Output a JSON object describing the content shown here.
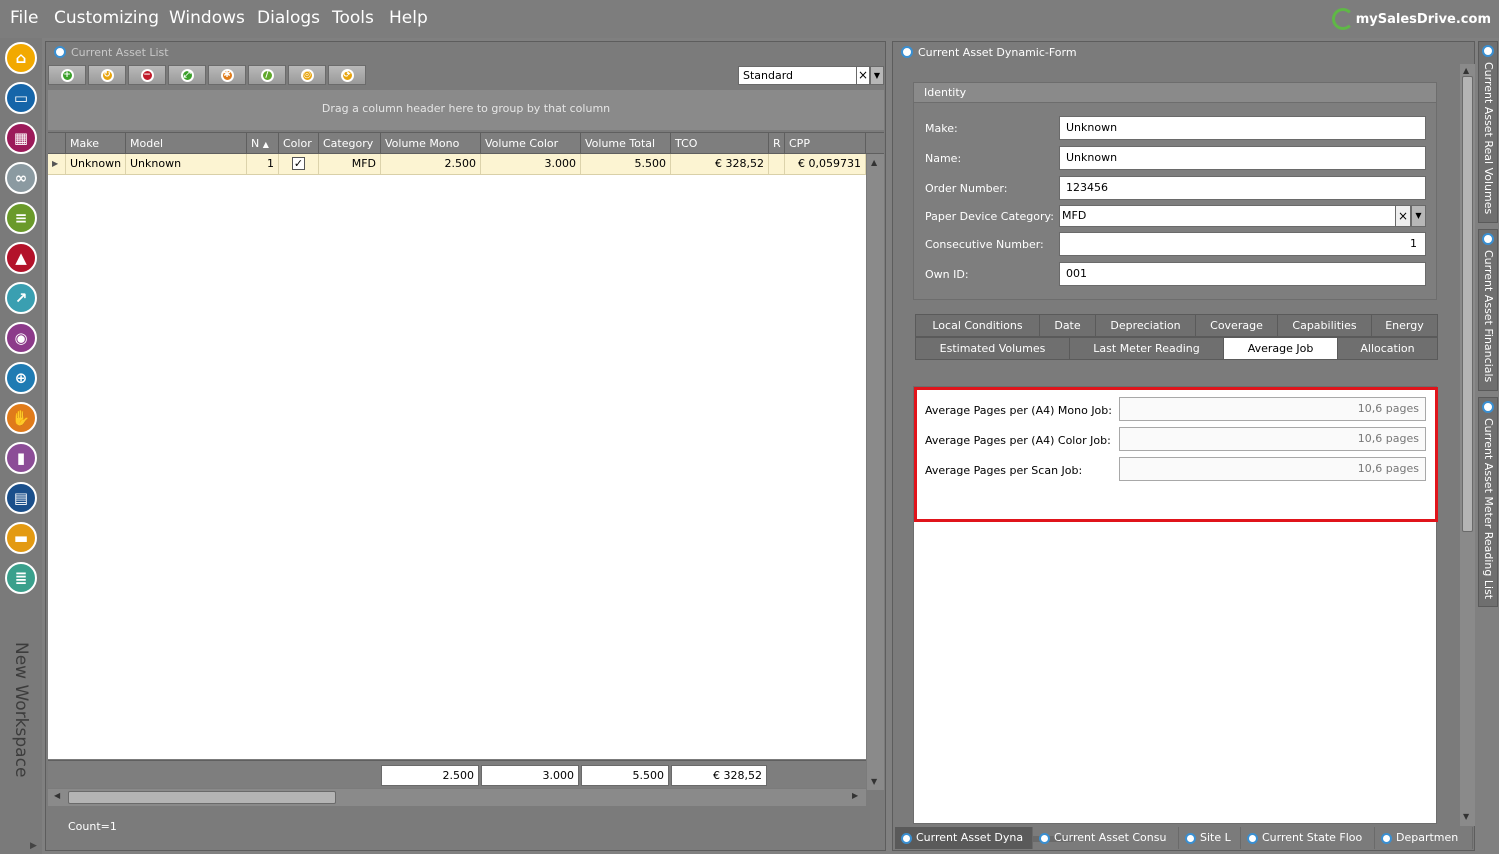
{
  "menu": {
    "items": [
      "File",
      "Customizing",
      "Windows",
      "Dialogs",
      "Tools",
      "Help"
    ],
    "brand": "mySalesDrive.com"
  },
  "sidebar": {
    "icons": [
      {
        "name": "home-icon",
        "color": "#f2a900",
        "glyph": "⌂"
      },
      {
        "name": "folder-icon",
        "color": "#1565a9",
        "glyph": "▭"
      },
      {
        "name": "hierarchy-icon",
        "color": "#9c1a5a",
        "glyph": "▦"
      },
      {
        "name": "binoculars-icon",
        "color": "#8b9aa1",
        "glyph": "∞"
      },
      {
        "name": "scroll-icon",
        "color": "#6a9a2a",
        "glyph": "≡"
      },
      {
        "name": "chart-icon",
        "color": "#b3122a",
        "glyph": "▲"
      },
      {
        "name": "trend-icon",
        "color": "#3a9fb1",
        "glyph": "↗"
      },
      {
        "name": "eye-icon",
        "color": "#8c3a8a",
        "glyph": "◉"
      },
      {
        "name": "target-icon",
        "color": "#1f7bb3",
        "glyph": "⊕"
      },
      {
        "name": "handshake-icon",
        "color": "#e07b1a",
        "glyph": "✋"
      },
      {
        "name": "bar-chart-icon",
        "color": "#8c4d97",
        "glyph": "▮"
      },
      {
        "name": "document-icon",
        "color": "#1a4f8b",
        "glyph": "▤"
      },
      {
        "name": "briefcase-icon",
        "color": "#e39a12",
        "glyph": "▬"
      },
      {
        "name": "database-icon",
        "color": "#3aa08c",
        "glyph": "≣"
      }
    ],
    "workspace_label": "New Workspace"
  },
  "left_panel": {
    "title": "Current Asset List",
    "view_select": "Standard",
    "group_hint": "Drag a column header here to group by that column",
    "columns": [
      "Make",
      "Model",
      "N",
      "Color",
      "Category",
      "Volume Mono",
      "Volume Color",
      "Volume Total",
      "TCO",
      "R",
      "CPP"
    ],
    "row": {
      "make": "Unknown",
      "model": "Unknown",
      "n": "1",
      "color_checked": "✓",
      "category": "MFD",
      "volume_mono": "2.500",
      "volume_color": "3.000",
      "volume_total": "5.500",
      "tco": "€ 328,52",
      "cpp": "€ 0,059731"
    },
    "totals": {
      "volume_mono": "2.500",
      "volume_color": "3.000",
      "volume_total": "5.500",
      "tco": "€ 328,52"
    },
    "count": "Count=1"
  },
  "right_panel": {
    "title": "Current Asset Dynamic-Form",
    "identity": {
      "title": "Identity",
      "fields": [
        {
          "label": "Make:",
          "value": "Unknown"
        },
        {
          "label": "Name:",
          "value": "Unknown"
        },
        {
          "label": "Order Number:",
          "value": "123456"
        },
        {
          "label": "Paper Device Category:",
          "value": "MFD"
        },
        {
          "label": "Consecutive Number:",
          "value": "1"
        },
        {
          "label": "Own ID:",
          "value": "001"
        }
      ]
    },
    "tabs_row1": [
      "Local Conditions",
      "Date",
      "Depreciation",
      "Coverage",
      "Capabilities",
      "Energy"
    ],
    "tabs_row2": [
      "Estimated Volumes",
      "Last Meter Reading",
      "Average Job",
      "Allocation"
    ],
    "active_tab": "Average Job",
    "average_job": [
      {
        "label": "Average Pages per (A4) Mono Job:",
        "value": "10,6 pages"
      },
      {
        "label": "Average Pages per (A4) Color Job:",
        "value": "10,6 pages"
      },
      {
        "label": "Average Pages per Scan Job:",
        "value": "10,6 pages"
      }
    ],
    "bottom_tabs": [
      "Current Asset Dyna",
      "Current Asset Consu",
      "Site L",
      "Current State Floo",
      "Departmen"
    ]
  },
  "vertical_tabs": [
    "Current Asset Real Volumes",
    "Current Asset Financials",
    "Current Asset Meter Reading List"
  ],
  "colors": {
    "highlight": "#e0141b",
    "selected_row": "#fcf4d2",
    "brand_green": "#5fb846"
  }
}
